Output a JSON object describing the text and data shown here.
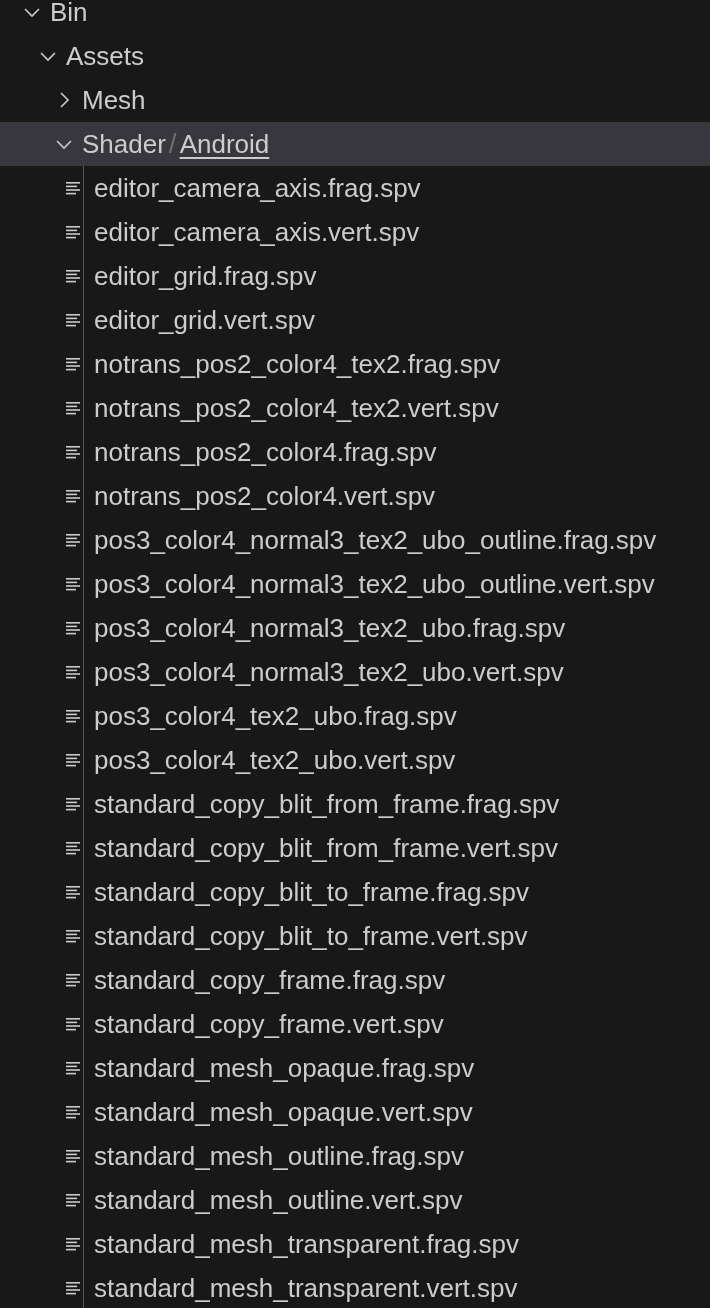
{
  "explorer": {
    "tree": [
      {
        "kind": "folder",
        "segments": [
          "Bin"
        ],
        "expanded": true,
        "selected": false,
        "children": [
          {
            "kind": "folder",
            "segments": [
              "Assets"
            ],
            "expanded": true,
            "selected": false,
            "children": [
              {
                "kind": "folder",
                "segments": [
                  "Mesh"
                ],
                "expanded": false,
                "selected": false
              },
              {
                "kind": "folder",
                "segments": [
                  "Shader",
                  "Android"
                ],
                "separator": "/",
                "expanded": true,
                "selected": true,
                "children": [
                  {
                    "kind": "file",
                    "name": "editor_camera_axis.frag.spv"
                  },
                  {
                    "kind": "file",
                    "name": "editor_camera_axis.vert.spv"
                  },
                  {
                    "kind": "file",
                    "name": "editor_grid.frag.spv"
                  },
                  {
                    "kind": "file",
                    "name": "editor_grid.vert.spv"
                  },
                  {
                    "kind": "file",
                    "name": "notrans_pos2_color4_tex2.frag.spv"
                  },
                  {
                    "kind": "file",
                    "name": "notrans_pos2_color4_tex2.vert.spv"
                  },
                  {
                    "kind": "file",
                    "name": "notrans_pos2_color4.frag.spv"
                  },
                  {
                    "kind": "file",
                    "name": "notrans_pos2_color4.vert.spv"
                  },
                  {
                    "kind": "file",
                    "name": "pos3_color4_normal3_tex2_ubo_outline.frag.spv"
                  },
                  {
                    "kind": "file",
                    "name": "pos3_color4_normal3_tex2_ubo_outline.vert.spv"
                  },
                  {
                    "kind": "file",
                    "name": "pos3_color4_normal3_tex2_ubo.frag.spv"
                  },
                  {
                    "kind": "file",
                    "name": "pos3_color4_normal3_tex2_ubo.vert.spv"
                  },
                  {
                    "kind": "file",
                    "name": "pos3_color4_tex2_ubo.frag.spv"
                  },
                  {
                    "kind": "file",
                    "name": "pos3_color4_tex2_ubo.vert.spv"
                  },
                  {
                    "kind": "file",
                    "name": "standard_copy_blit_from_frame.frag.spv"
                  },
                  {
                    "kind": "file",
                    "name": "standard_copy_blit_from_frame.vert.spv"
                  },
                  {
                    "kind": "file",
                    "name": "standard_copy_blit_to_frame.frag.spv"
                  },
                  {
                    "kind": "file",
                    "name": "standard_copy_blit_to_frame.vert.spv"
                  },
                  {
                    "kind": "file",
                    "name": "standard_copy_frame.frag.spv"
                  },
                  {
                    "kind": "file",
                    "name": "standard_copy_frame.vert.spv"
                  },
                  {
                    "kind": "file",
                    "name": "standard_mesh_opaque.frag.spv"
                  },
                  {
                    "kind": "file",
                    "name": "standard_mesh_opaque.vert.spv"
                  },
                  {
                    "kind": "file",
                    "name": "standard_mesh_outline.frag.spv"
                  },
                  {
                    "kind": "file",
                    "name": "standard_mesh_outline.vert.spv"
                  },
                  {
                    "kind": "file",
                    "name": "standard_mesh_transparent.frag.spv"
                  },
                  {
                    "kind": "file",
                    "name": "standard_mesh_transparent.vert.spv"
                  }
                ]
              }
            ]
          }
        ]
      }
    ]
  }
}
